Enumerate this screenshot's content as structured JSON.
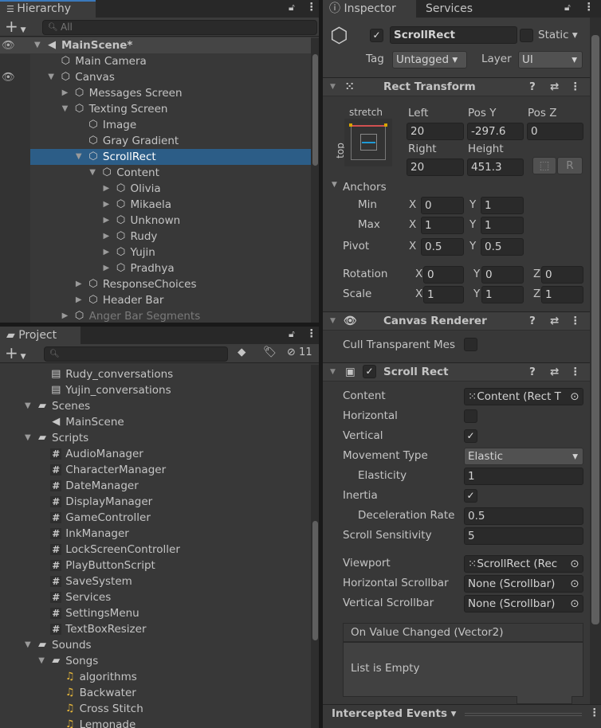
{
  "hierarchy": {
    "tab": "Hierarchy",
    "search_placeholder": "All",
    "items": [
      {
        "label": "MainScene*",
        "level": 0,
        "arrow": "expanded",
        "icon": "unity-scene-icon",
        "header": true
      },
      {
        "label": "Main Camera",
        "level": 1,
        "arrow": "none",
        "icon": "cube-icon"
      },
      {
        "label": "Canvas",
        "level": 1,
        "arrow": "expanded",
        "icon": "cube-icon"
      },
      {
        "label": "Messages Screen",
        "level": 2,
        "arrow": "collapsed",
        "icon": "cube-icon"
      },
      {
        "label": "Texting Screen",
        "level": 2,
        "arrow": "expanded",
        "icon": "cube-icon"
      },
      {
        "label": "Image",
        "level": 3,
        "arrow": "none",
        "icon": "cube-icon"
      },
      {
        "label": "Gray Gradient",
        "level": 3,
        "arrow": "none",
        "icon": "cube-icon"
      },
      {
        "label": "ScrollRect",
        "level": 3,
        "arrow": "expanded",
        "icon": "cube-icon",
        "selected": true
      },
      {
        "label": "Content",
        "level": 4,
        "arrow": "expanded",
        "icon": "cube-icon"
      },
      {
        "label": "Olivia",
        "level": 5,
        "arrow": "collapsed",
        "icon": "cube-icon"
      },
      {
        "label": "Mikaela",
        "level": 5,
        "arrow": "collapsed",
        "icon": "cube-icon"
      },
      {
        "label": "Unknown",
        "level": 5,
        "arrow": "collapsed",
        "icon": "cube-icon"
      },
      {
        "label": "Rudy",
        "level": 5,
        "arrow": "collapsed",
        "icon": "cube-icon"
      },
      {
        "label": "Yujin",
        "level": 5,
        "arrow": "collapsed",
        "icon": "cube-icon"
      },
      {
        "label": "Pradhya",
        "level": 5,
        "arrow": "collapsed",
        "icon": "cube-icon"
      },
      {
        "label": "ResponseChoices",
        "level": 3,
        "arrow": "collapsed",
        "icon": "cube-icon"
      },
      {
        "label": "Header Bar",
        "level": 3,
        "arrow": "collapsed",
        "icon": "cube-icon"
      },
      {
        "label": "Anger Bar Segments",
        "level": 2,
        "arrow": "collapsed",
        "icon": "cube-icon",
        "dim": true
      }
    ]
  },
  "project": {
    "tab": "Project",
    "hidden_count": "11",
    "items": [
      {
        "label": "Rudy_conversations",
        "level": 2,
        "arrow": "none",
        "icon": "ink-file-icon"
      },
      {
        "label": "Yujin_conversations",
        "level": 2,
        "arrow": "none",
        "icon": "ink-file-icon"
      },
      {
        "label": "Scenes",
        "level": 1,
        "arrow": "expanded",
        "icon": "folder-icon"
      },
      {
        "label": "MainScene",
        "level": 2,
        "arrow": "none",
        "icon": "unity-scene-icon"
      },
      {
        "label": "Scripts",
        "level": 1,
        "arrow": "expanded",
        "icon": "folder-icon"
      },
      {
        "label": "AudioManager",
        "level": 2,
        "arrow": "none",
        "icon": "csharp-script-icon"
      },
      {
        "label": "CharacterManager",
        "level": 2,
        "arrow": "none",
        "icon": "csharp-script-icon"
      },
      {
        "label": "DateManager",
        "level": 2,
        "arrow": "none",
        "icon": "csharp-script-icon"
      },
      {
        "label": "DisplayManager",
        "level": 2,
        "arrow": "none",
        "icon": "csharp-script-icon"
      },
      {
        "label": "GameController",
        "level": 2,
        "arrow": "none",
        "icon": "csharp-script-icon"
      },
      {
        "label": "InkManager",
        "level": 2,
        "arrow": "none",
        "icon": "csharp-script-icon"
      },
      {
        "label": "LockScreenController",
        "level": 2,
        "arrow": "none",
        "icon": "csharp-script-icon"
      },
      {
        "label": "PlayButtonScript",
        "level": 2,
        "arrow": "none",
        "icon": "csharp-script-icon"
      },
      {
        "label": "SaveSystem",
        "level": 2,
        "arrow": "none",
        "icon": "csharp-script-icon"
      },
      {
        "label": "Services",
        "level": 2,
        "arrow": "none",
        "icon": "csharp-script-icon"
      },
      {
        "label": "SettingsMenu",
        "level": 2,
        "arrow": "none",
        "icon": "csharp-script-icon"
      },
      {
        "label": "TextBoxResizer",
        "level": 2,
        "arrow": "none",
        "icon": "csharp-script-icon"
      },
      {
        "label": "Sounds",
        "level": 1,
        "arrow": "expanded",
        "icon": "folder-icon"
      },
      {
        "label": "Songs",
        "level": 2,
        "arrow": "expanded",
        "icon": "folder-icon"
      },
      {
        "label": "algorithms",
        "level": 3,
        "arrow": "none",
        "icon": "audio-clip-icon"
      },
      {
        "label": "Backwater",
        "level": 3,
        "arrow": "none",
        "icon": "audio-clip-icon"
      },
      {
        "label": "Cross Stitch",
        "level": 3,
        "arrow": "none",
        "icon": "audio-clip-icon"
      },
      {
        "label": "Lemonade",
        "level": 3,
        "arrow": "none",
        "icon": "audio-clip-icon"
      }
    ]
  },
  "inspector": {
    "tab": "Inspector",
    "tab2": "Services",
    "object": {
      "name": "ScrollRect",
      "active": true,
      "static_label": "Static",
      "static": false,
      "tag_label": "Tag",
      "tag": "Untagged",
      "layer_label": "Layer",
      "layer": "UI"
    },
    "rect_transform": {
      "title": "Rect Transform",
      "preset_h": "stretch",
      "preset_v": "top",
      "left_label": "Left",
      "left": "20",
      "posy_label": "Pos Y",
      "posy": "-297.6",
      "posz_label": "Pos Z",
      "posz": "0",
      "right_label": "Right",
      "right": "20",
      "height_label": "Height",
      "height": "451.3",
      "raw_label": "R",
      "anchors_label": "Anchors",
      "min_label": "Min",
      "min_x": "0",
      "min_y": "1",
      "max_label": "Max",
      "max_x": "1",
      "max_y": "1",
      "pivot_label": "Pivot",
      "pivot_x": "0.5",
      "pivot_y": "0.5",
      "rotation_label": "Rotation",
      "rot_x": "0",
      "rot_y": "0",
      "rot_z": "0",
      "scale_label": "Scale",
      "scale_x": "1",
      "scale_y": "1",
      "scale_z": "1",
      "x": "X",
      "y": "Y",
      "z": "Z"
    },
    "canvas_renderer": {
      "title": "Canvas Renderer",
      "cull_label": "Cull Transparent Mes",
      "cull": false
    },
    "scroll_rect": {
      "title": "Scroll Rect",
      "enabled": true,
      "content_label": "Content",
      "content": "Content (Rect T",
      "horizontal_label": "Horizontal",
      "horizontal": false,
      "vertical_label": "Vertical",
      "vertical": true,
      "movement_label": "Movement Type",
      "movement": "Elastic",
      "elasticity_label": "Elasticity",
      "elasticity": "1",
      "inertia_label": "Inertia",
      "inertia": true,
      "decel_label": "Deceleration Rate",
      "decel": "0.5",
      "sens_label": "Scroll Sensitivity",
      "sens": "5",
      "viewport_label": "Viewport",
      "viewport": "ScrollRect (Rec",
      "hscroll_label": "Horizontal Scrollbar",
      "hscroll": "None (Scrollbar)",
      "vscroll_label": "Vertical Scrollbar",
      "vscroll": "None (Scrollbar)",
      "event_title": "On Value Changed (Vector2)",
      "event_empty": "List is Empty"
    },
    "bottom": {
      "label": "Intercepted Events"
    }
  },
  "colors": {
    "selection": "#2c5d87",
    "anchor_red": "#d05050",
    "anchor_yellow": "#d8a400",
    "anchor_blue": "#1e9ad6"
  }
}
